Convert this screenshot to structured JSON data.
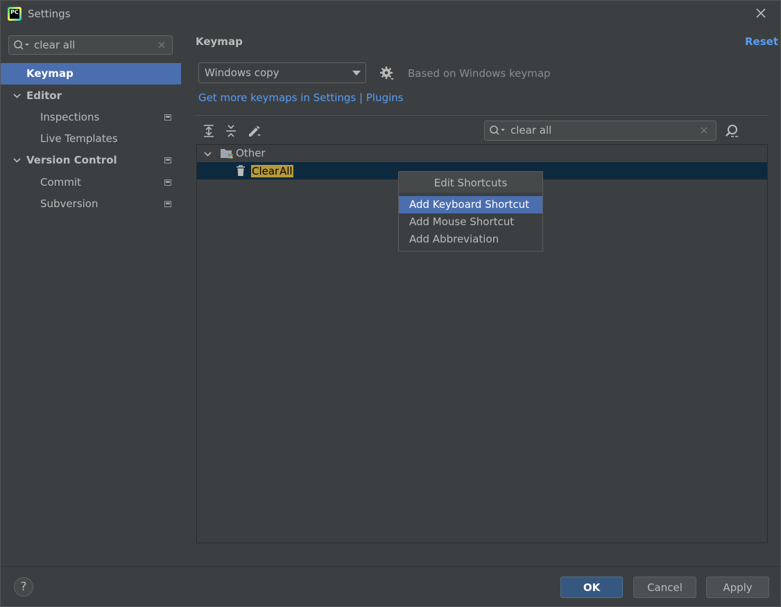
{
  "window": {
    "title": "Settings"
  },
  "sidebar": {
    "search_value": "clear all",
    "items": [
      {
        "label": "Keymap"
      },
      {
        "label": "Editor"
      },
      {
        "label": "Inspections"
      },
      {
        "label": "Live Templates"
      },
      {
        "label": "Version Control"
      },
      {
        "label": "Commit"
      },
      {
        "label": "Subversion"
      }
    ]
  },
  "main": {
    "title": "Keymap",
    "reset_label": "Reset",
    "keymap_combo_value": "Windows copy",
    "based_on": "Based on Windows keymap",
    "links": "Get more keymaps in Settings | Plugins",
    "search_value": "clear all",
    "tree": {
      "group": "Other",
      "action_parts": [
        "Clear",
        "All"
      ]
    }
  },
  "popup": {
    "header": "Edit Shortcuts",
    "items": [
      "Add Keyboard Shortcut",
      "Add Mouse Shortcut",
      "Add Abbreviation"
    ]
  },
  "footer": {
    "help": "?",
    "ok": "OK",
    "cancel": "Cancel",
    "apply": "Apply"
  },
  "colors": {
    "background": "#3c3f41",
    "selection": "#4b6eaf",
    "tree_selection": "#0d293e",
    "link": "#589df6",
    "highlight": "#b89a3c"
  },
  "icons": [
    "app-icon",
    "close-icon",
    "search-icon",
    "clear-icon",
    "chevron-down-icon",
    "project-level-icon",
    "gear-icon",
    "expand-all-icon",
    "collapse-all-icon",
    "edit-icon",
    "find-shortcut-icon",
    "folder-icon",
    "trash-icon",
    "help-icon"
  ]
}
